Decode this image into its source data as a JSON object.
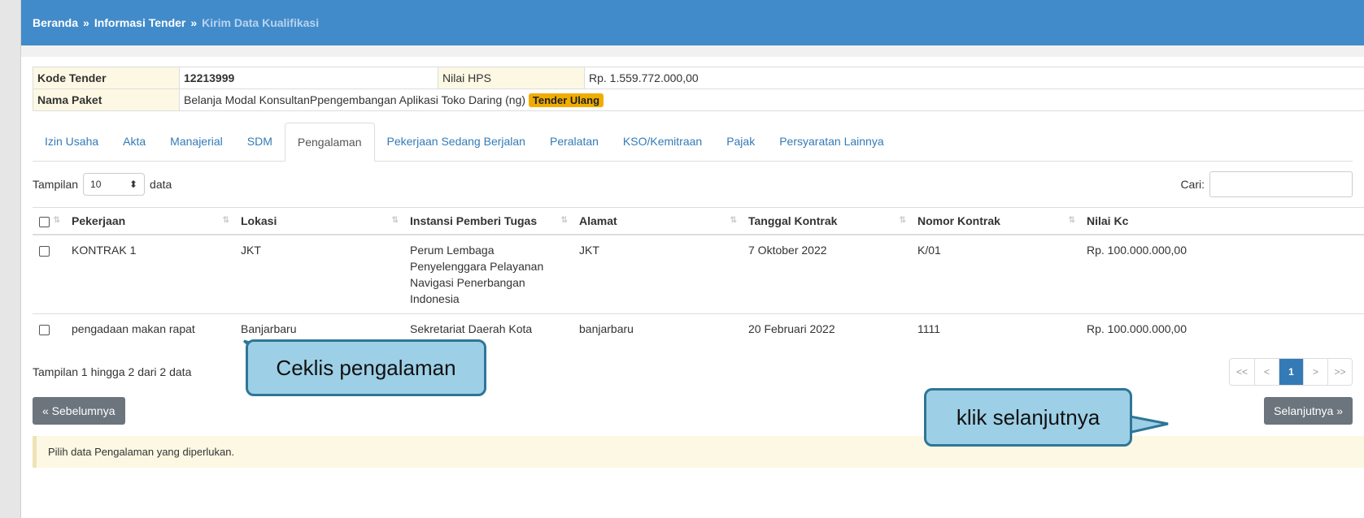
{
  "breadcrumb": {
    "home": "Beranda",
    "sep": "»",
    "section": "Informasi Tender",
    "current": "Kirim Data Kualifikasi"
  },
  "info": {
    "kode_label": "Kode Tender",
    "kode_value": "12213999",
    "hps_label": "Nilai HPS",
    "hps_value": "Rp. 1.559.772.000,00",
    "paket_label": "Nama Paket",
    "paket_value": "Belanja Modal KonsultanPpengembangan Aplikasi Toko Daring (ng)",
    "badge": "Tender Ulang"
  },
  "tabs": [
    "Izin Usaha",
    "Akta",
    "Manajerial",
    "SDM",
    "Pengalaman",
    "Pekerjaan Sedang Berjalan",
    "Peralatan",
    "KSO/Kemitraan",
    "Pajak",
    "Persyaratan Lainnya"
  ],
  "active_tab": "Pengalaman",
  "controls": {
    "show_prefix": "Tampilan",
    "show_value": "10",
    "show_suffix": "data",
    "search_label": "Cari:"
  },
  "table": {
    "columns": [
      "Pekerjaan",
      "Lokasi",
      "Instansi Pemberi Tugas",
      "Alamat",
      "Tanggal Kontrak",
      "Nomor Kontrak",
      "Nilai Kc"
    ],
    "rows": [
      {
        "pekerjaan": "KONTRAK 1",
        "lokasi": "JKT",
        "instansi": "Perum Lembaga Penyelenggara Pelayanan Navigasi Penerbangan Indonesia",
        "alamat": "JKT",
        "tanggal": "7 Oktober 2022",
        "nomor": "K/01",
        "nilai": "Rp. 100.000.000,00"
      },
      {
        "pekerjaan": "pengadaan makan rapat",
        "lokasi": "Banjarbaru",
        "instansi": "Sekretariat Daerah Kota",
        "alamat": "banjarbaru",
        "tanggal": "20 Februari 2022",
        "nomor": "1111",
        "nilai": "Rp. 100.000.000,00"
      }
    ]
  },
  "footer": {
    "info": "Tampilan 1 hingga 2 dari 2 data"
  },
  "pager": {
    "first": "<<",
    "prev": "<",
    "page": "1",
    "next": ">",
    "last": ">>"
  },
  "buttons": {
    "prev": "« Sebelumnya",
    "next": "Selanjutnya »"
  },
  "alert": "Pilih data Pengalaman yang diperlukan.",
  "callouts": {
    "checklist": "Ceklis pengalaman",
    "next": "klik selanjutnya"
  },
  "colors": {
    "header": "#428bca",
    "callout_fill": "#9dd0e6",
    "callout_border": "#2e7696",
    "badge": "#f0ad00"
  }
}
